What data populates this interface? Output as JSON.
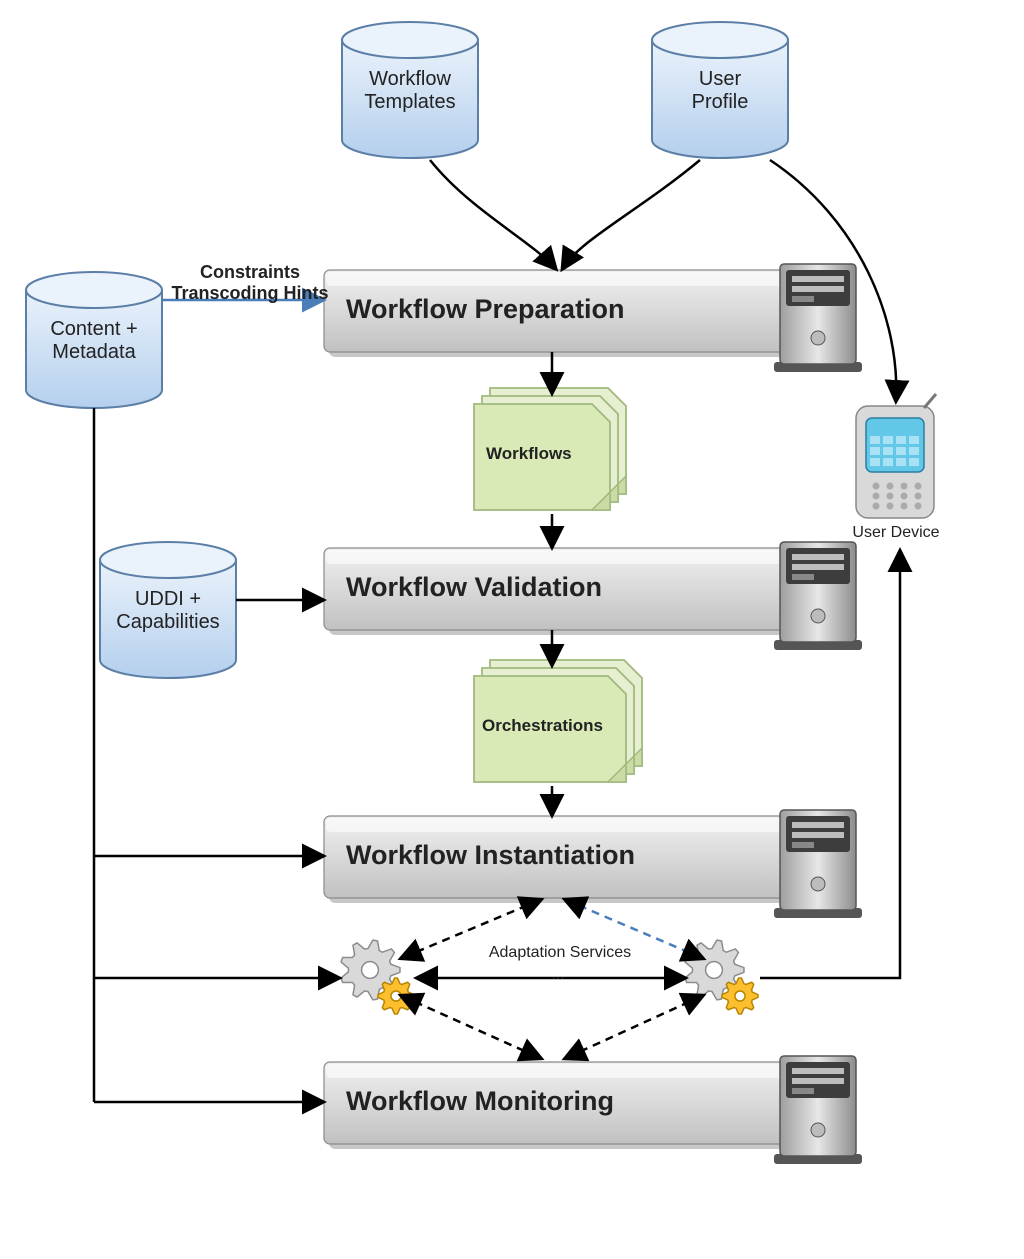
{
  "cylinders": {
    "workflow_templates": "Workflow\nTemplates",
    "user_profile": "User\nProfile",
    "content_metadata": "Content +\nMetadata",
    "uddi": "UDDI +\nCapabilities"
  },
  "processes": {
    "preparation": "Workflow Preparation",
    "validation": "Workflow Validation",
    "instantiation": "Workflow Instantiation",
    "monitoring": "Workflow Monitoring"
  },
  "documents": {
    "workflows": "Workflows",
    "orchestrations": "Orchestrations"
  },
  "labels": {
    "constraints": "Constraints\nTranscoding Hints",
    "adaptation_services": "Adaptation Services",
    "ellipsis": "...",
    "user_device": "User Device"
  },
  "colors": {
    "cylinder_fill": "#c3daf4",
    "cylinder_stroke": "#5b7fa6",
    "proc_fill_top": "#e9e9e9",
    "proc_fill_bot": "#c1c1c1",
    "proc_stroke": "#8a8a8a",
    "doc_fill": "#d9eab7",
    "doc_stroke": "#a1b87f",
    "arrow_blue": "#4a7ebb",
    "gear_gray": "#b5b5b5",
    "gear_gold": "#fdbf2d",
    "device_body": "#d9d9d9",
    "device_screen": "#63c7e8"
  }
}
